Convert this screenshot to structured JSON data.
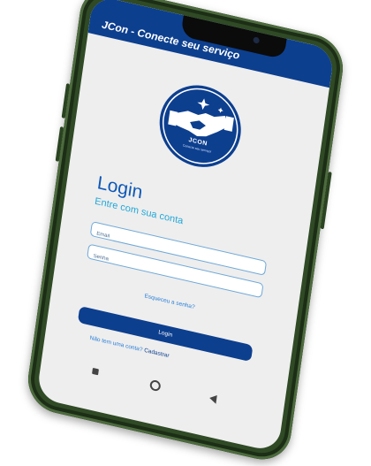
{
  "appbar": {
    "title": "JCon - Conecte seu serviço"
  },
  "logo": {
    "name": "JCON",
    "tagline": "Conecte seu serviço!"
  },
  "login": {
    "title": "Login",
    "subtitle": "Entre com sua conta",
    "email_placeholder": "Email",
    "password_placeholder": "Senha",
    "forgot_label": "Esqueceu a senha?",
    "button_label": "Login",
    "signup_prompt": "Não tem uma conta?",
    "signup_link": "Cadastrar"
  },
  "colors": {
    "primary": "#0d3f8f",
    "accent_text": "#0e58b8",
    "subtitle": "#22a7d8",
    "phone_frame": "#2f4a25",
    "screen_bg": "#eeeeee"
  },
  "icons": [
    "handshake-icon",
    "nav-recents-icon",
    "nav-home-icon",
    "nav-back-icon"
  ]
}
